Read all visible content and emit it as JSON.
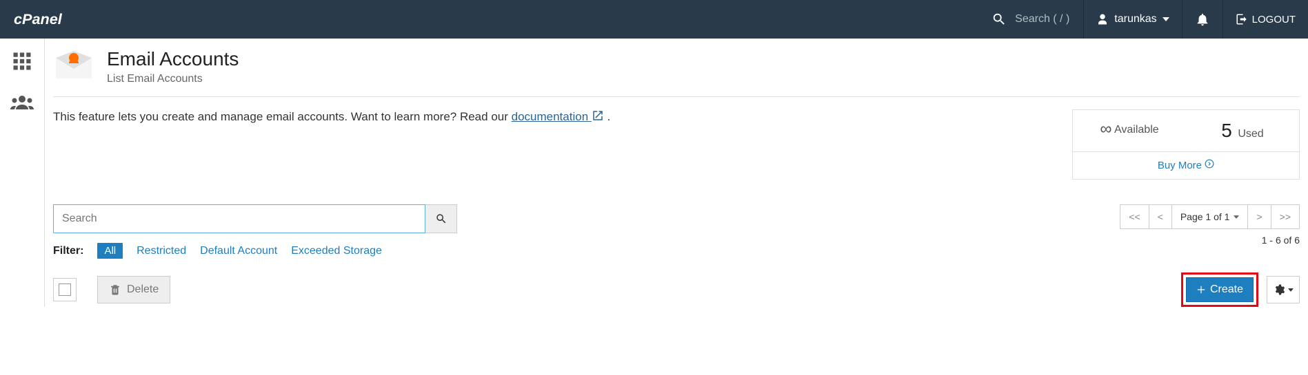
{
  "header": {
    "search_placeholder": "Search ( / )",
    "username": "tarunkas",
    "logout_label": "LOGOUT"
  },
  "page": {
    "title": "Email Accounts",
    "subtitle": "List Email Accounts",
    "intro_pre": "This feature lets you create and manage email accounts. Want to learn more? Read our ",
    "intro_link": "documentation",
    "intro_post": " ."
  },
  "stats": {
    "available_value": "∞",
    "available_label": "Available",
    "used_value": "5",
    "used_label": "Used",
    "buy_more": "Buy More"
  },
  "search": {
    "placeholder": "Search"
  },
  "filter": {
    "label": "Filter:",
    "all": "All",
    "restricted": "Restricted",
    "default": "Default Account",
    "exceeded": "Exceeded Storage"
  },
  "paging": {
    "first": "<<",
    "prev": "<",
    "label": "Page 1 of 1",
    "next": ">",
    "last": ">>",
    "range": "1 - 6 of 6"
  },
  "actions": {
    "delete": "Delete",
    "create": "Create"
  }
}
